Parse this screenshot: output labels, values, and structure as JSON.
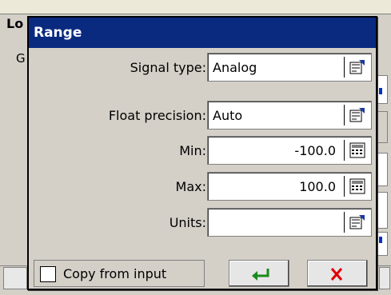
{
  "background_window": {
    "title": "Lo",
    "label": "G"
  },
  "dialog": {
    "title": "Range",
    "fields": {
      "signal_type": {
        "label": "Signal type:",
        "value": "Analog",
        "icon": "list-picker-icon"
      },
      "float_precision": {
        "label": "Float precision:",
        "value": "Auto",
        "icon": "list-picker-icon"
      },
      "min": {
        "label": "Min:",
        "value": "-100.0",
        "icon": "keypad-icon"
      },
      "max": {
        "label": "Max:",
        "value": "100.0",
        "icon": "keypad-icon"
      },
      "units": {
        "label": "Units:",
        "value": "",
        "icon": "list-picker-icon"
      }
    },
    "copy_from_input": {
      "label": "Copy from input",
      "checked": false
    },
    "buttons": {
      "ok": {
        "icon": "enter-arrow-icon",
        "color": "#1a8a1a"
      },
      "cancel": {
        "icon": "close-x-icon",
        "color": "#e00000"
      }
    },
    "colors": {
      "titlebar": "#0a2a80",
      "title_text": "#ffffff"
    }
  }
}
